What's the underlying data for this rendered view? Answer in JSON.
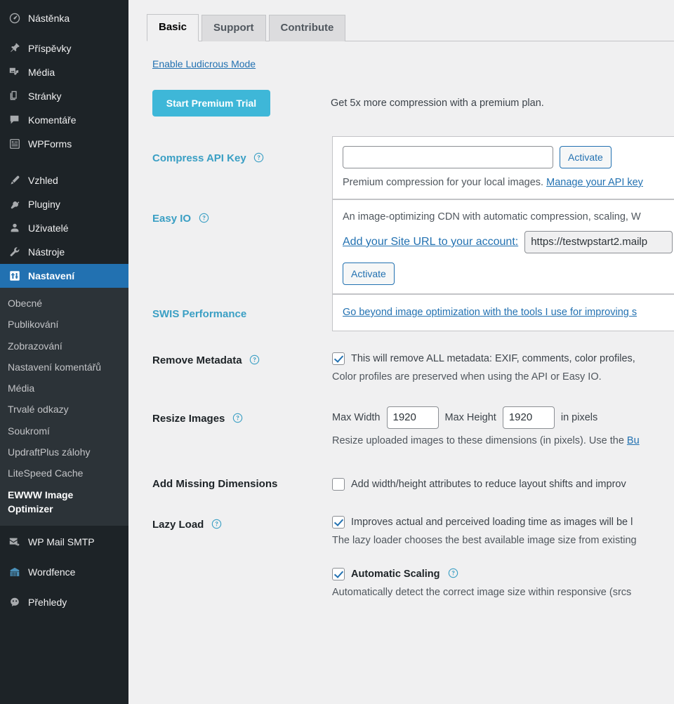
{
  "sidebar": {
    "items": [
      {
        "label": "Nástěnka",
        "icon": "dashboard-icon",
        "current": false
      },
      {
        "label": "Příspěvky",
        "icon": "pin-icon",
        "current": false
      },
      {
        "label": "Média",
        "icon": "media-icon",
        "current": false
      },
      {
        "label": "Stránky",
        "icon": "pages-icon",
        "current": false
      },
      {
        "label": "Komentáře",
        "icon": "comments-icon",
        "current": false
      },
      {
        "label": "WPForms",
        "icon": "wpforms-icon",
        "current": false
      },
      {
        "label": "Vzhled",
        "icon": "appearance-icon",
        "current": false
      },
      {
        "label": "Pluginy",
        "icon": "plugins-icon",
        "current": false
      },
      {
        "label": "Uživatelé",
        "icon": "users-icon",
        "current": false
      },
      {
        "label": "Nástroje",
        "icon": "tools-icon",
        "current": false
      },
      {
        "label": "Nastavení",
        "icon": "settings-icon",
        "current": true
      }
    ],
    "submenu": [
      {
        "label": "Obecné",
        "current": false
      },
      {
        "label": "Publikování",
        "current": false
      },
      {
        "label": "Zobrazování",
        "current": false
      },
      {
        "label": "Nastavení komentářů",
        "current": false
      },
      {
        "label": "Média",
        "current": false
      },
      {
        "label": "Trvalé odkazy",
        "current": false
      },
      {
        "label": "Soukromí",
        "current": false
      },
      {
        "label": "UpdraftPlus zálohy",
        "current": false
      },
      {
        "label": "LiteSpeed Cache",
        "current": false
      },
      {
        "label": "EWWW Image Optimizer",
        "current": true
      }
    ],
    "bottom_items": [
      {
        "label": "WP Mail SMTP",
        "icon": "mail-icon"
      },
      {
        "label": "Wordfence",
        "icon": "wordfence-icon"
      },
      {
        "label": "Přehledy",
        "icon": "insights-icon"
      }
    ],
    "colors": {
      "bg": "#1d2327",
      "submenu_bg": "#2c3338",
      "current": "#2271b1"
    }
  },
  "tabs": [
    {
      "label": "Basic",
      "active": true
    },
    {
      "label": "Support",
      "active": false
    },
    {
      "label": "Contribute",
      "active": false
    }
  ],
  "ludicrous_link": "Enable Ludicrous Mode",
  "premium": {
    "button_label": "Start Premium Trial",
    "note": "Get 5x more compression with a premium plan.",
    "button_color": "#3eb7d8"
  },
  "settings": {
    "compress_api_key": {
      "label": "Compress API Key",
      "input_value": "",
      "input_placeholder": "",
      "activate_label": "Activate",
      "desc_prefix": "Premium compression for your local images. ",
      "desc_link": "Manage your API key"
    },
    "easy_io": {
      "label": "Easy IO",
      "desc": "An image-optimizing CDN with automatic compression, scaling, W",
      "site_url_link": "Add your Site URL to your account:",
      "site_url_value": "https://testwpstart2.mailp",
      "activate_label": "Activate"
    },
    "swis": {
      "label": "SWIS Performance",
      "link": "Go beyond image optimization with the tools I use for improving s"
    },
    "remove_metadata": {
      "label": "Remove Metadata",
      "checked": true,
      "checkbox_text": "This will remove ALL metadata: EXIF, comments, color profiles,",
      "sub_desc": "Color profiles are preserved when using the API or Easy IO."
    },
    "resize_images": {
      "label": "Resize Images",
      "max_width_label": "Max Width",
      "max_width_value": "1920",
      "max_height_label": "Max Height",
      "max_height_value": "1920",
      "units_label": "in pixels",
      "desc_prefix": "Resize uploaded images to these dimensions (in pixels). Use the ",
      "desc_link": "Bu"
    },
    "add_missing_dimensions": {
      "label": "Add Missing Dimensions",
      "checked": false,
      "checkbox_text": "Add width/height attributes to reduce layout shifts and improv"
    },
    "lazy_load": {
      "label": "Lazy Load",
      "checked": true,
      "checkbox_text": "Improves actual and perceived loading time as images will be l",
      "sub_desc": "The lazy loader chooses the best available image size from existing",
      "automatic_scaling": {
        "label": "Automatic Scaling",
        "checked": true,
        "desc": "Automatically detect the correct image size within responsive (srcs"
      }
    }
  }
}
